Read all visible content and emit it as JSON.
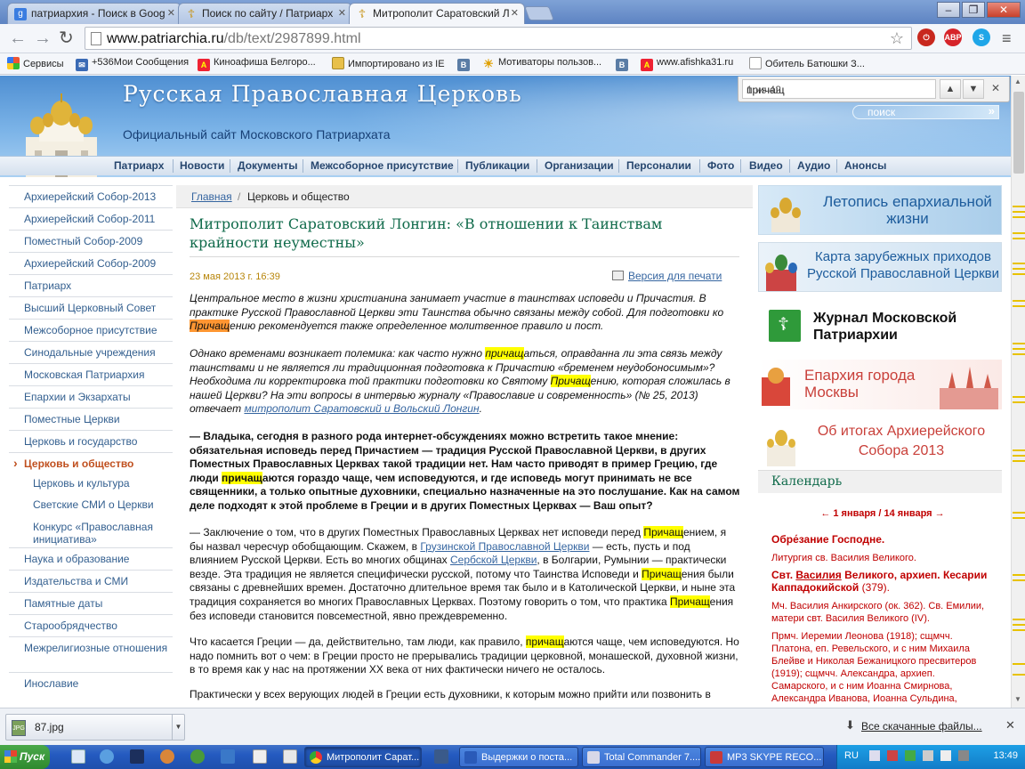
{
  "browser": {
    "tabs": [
      {
        "label": "патриархия - Поиск в Goog",
        "icon": "google-icon"
      },
      {
        "label": "Поиск по сайту / Патриарх",
        "icon": "orthodox-cross-icon"
      },
      {
        "label": "Митрополит Саратовский Л",
        "icon": "orthodox-cross-icon"
      }
    ],
    "url_domain": "www.patriarchia.ru",
    "url_path": "/db/text/2987899.html",
    "extensions": [
      "stop-icon",
      "ABP",
      "skype-icon"
    ],
    "bookmarks": [
      {
        "label": "Сервисы",
        "icon": "apps-icon"
      },
      {
        "label": "+536Мои Сообщения",
        "icon": "message-icon"
      },
      {
        "label": "Киноафиша Белгоро...",
        "icon": "afisha-icon"
      },
      {
        "label": "Импортировано из IE",
        "icon": "folder-icon"
      },
      {
        "label": "",
        "icon": "vk-icon"
      },
      {
        "label": "Мотиваторы пользов...",
        "icon": "sun-icon"
      },
      {
        "label": "",
        "icon": "vk-icon"
      },
      {
        "label": "www.afishka31.ru",
        "icon": "afisha-icon"
      },
      {
        "label": "Обитель Батюшки З...",
        "icon": "page-icon"
      }
    ]
  },
  "find": {
    "query": "причащ",
    "count": "1 из 42"
  },
  "site": {
    "title": "Русская  Православная  Церковь",
    "subtitle": "Официальный сайт Московского Патриархата",
    "search_label": "поиск",
    "nav": [
      "Патриарх",
      "Новости",
      "Документы",
      "Межсоборное присутствие",
      "Публикации",
      "Организации",
      "Персоналии",
      "Фото",
      "Видео",
      "Аудио",
      "Анонсы"
    ]
  },
  "sidebar": {
    "items": [
      "Архиерейский Собор-2013",
      "Архиерейский Собор-2011",
      "Поместный Собор-2009",
      "Архиерейский Собор-2009",
      "Патриарх",
      "Высший Церковный Совет",
      "Межсоборное присутствие",
      "Синодальные учреждения",
      "Московская Патриархия",
      "Епархии и Экзархаты",
      "Поместные Церкви",
      "Церковь и государство"
    ],
    "active": "Церковь и общество",
    "subitems": [
      "Церковь и культура",
      "Светские СМИ о Церкви",
      "Конкурс «Православная инициатива»"
    ],
    "items_after": [
      "Наука и образование",
      "Издательства и СМИ",
      "Памятные даты",
      "Старообрядчество",
      "Межрелигиозные отношения",
      "Инославие"
    ]
  },
  "article": {
    "crumb_home": "Главная",
    "crumb_current": "Церковь и общество",
    "title": "Митрополит Саратовский Лонгин: «В отношении к Таинствам крайности неуместны»",
    "date": "23 мая 2013 г. 16:39",
    "print_label": "Версия для печати",
    "p1": [
      "Центральное место в жизни христианина занимает участие в таинствах исповеди и Причастия. В практике Русской Православной Церкви эти Таинства обычно связаны между собой. Для подготовки ко ",
      "Причащ",
      "ению рекомендуется также определенное молитвенное правило и пост."
    ],
    "p2": [
      "Однако временами возникает полемика: как часто нужно ",
      "причащ",
      "аться, оправданна ли эта связь между таинствами и не является ли традиционная подготовка к Причастию «бременем неудобоносимым»? Необходима ли корректировка той практики подготовки ко Святому ",
      "Причащ",
      "ению, которая сложилась в нашей Церкви? На эти вопросы в интервью журналу «Православие и современность» (№ 25, 2013) отвечает ",
      "митрополит Саратовский и Вольский Лонгин",
      "."
    ],
    "q1": [
      "— Владыка, сегодня в разного рода интернет-обсуждениях можно встретить такое мнение: обязательная исповедь перед Причастием — традиция Русской Православной Церкви, в других Поместных Православных Церквах такой традиции нет. Нам часто приводят в пример Грецию, где люди ",
      "причащ",
      "аются гораздо чаще, чем исповедуются, и где исповедь могут принимать не все священники, а только опытные духовники, специально назначенные на это послушание. Как на самом деле подходят к этой проблеме в Греции и в других Поместных Церквах — Ваш опыт?"
    ],
    "a1": [
      "— Заключение о том, что в других Поместных Православных Церквах нет исповеди перед ",
      "Причащ",
      "ением, я бы назвал чересчур обобщающим. Скажем, в ",
      "Грузинской Православной Церкви",
      " — есть, пусть и под влиянием Русской Церкви. Есть во многих общинах ",
      "Сербской Церкви",
      ", в Болгарии, Румынии — практически везде. Эта традиция не является специфически русской, потому что Таинства Исповеди и ",
      "Причащ",
      "ения были связаны с древнейших времен. Достаточно длительное время так было и в Католической Церкви, и ныне эта традиция сохраняется во многих Православных Церквах. Поэтому говорить о том, что практика ",
      "Причащ",
      "ения без исповеди становится повсеместной, явно преждевременно."
    ],
    "a2": [
      "Что касается Греции — да, действительно, там люди, как правило, ",
      "причащ",
      "аются чаще, чем исповедуются. Но надо помнить вот о чем: в Греции просто не прерывались традиции церковной, монашеской, духовной жизни, в то время как у нас на протяжении XX века от них фактически ничего не осталось."
    ],
    "a3": "Практически у всех верующих людей в Греции есть духовники, к которым можно прийти или позвонить в"
  },
  "right": {
    "banners": [
      "Летопись епархиальной жизни",
      "Карта зарубежных приходов Русской Православной Церкви",
      "Журнал Московской Патриархии",
      "Епархия города Москвы",
      "Об итогах Архиерейского Собора 2013"
    ],
    "calendar_title": "Календарь",
    "cal_nav": "← 1 января / 14 января →",
    "cal_feast": "Обре́зание Господне.",
    "cal_lit": "Литургия св. Василия Великого.",
    "cal_saint": [
      "Свт. ",
      "Василия",
      " Великого, архиеп. Кесарии Каппадокийской",
      " (379)."
    ],
    "cal_1": "Мч. Василия Анкирского (ок. 362). Св. Емилии, матери свт. Василия Великого (IV).",
    "cal_2": "Прмч. Иеремии Леонова (1918); сщмчч. Платона, еп. Ревельского, и с ним Михаила Блейве и Николая Бежаницкого пресвитеров (1919); сщмчч. Александра, архиеп. Самарского, и с ним Иоанна Смирнова, Александра Иванова, Иоанна Сульдина,"
  },
  "downloads": {
    "file": "87.jpg",
    "all_label": "Все скачанные файлы..."
  },
  "taskbar": {
    "start": "Пуск",
    "tasks": [
      "Митрополит Сарат...",
      "Выдержки о поста...",
      "Total Commander 7....",
      "MP3 SKYPE RECO..."
    ],
    "lang": "RU",
    "clock": "13:49"
  }
}
